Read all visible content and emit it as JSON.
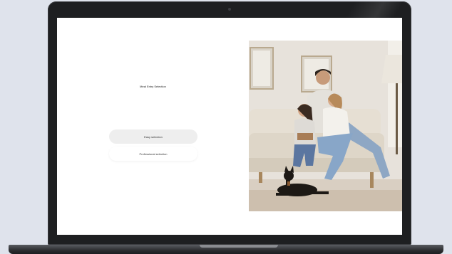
{
  "selection": {
    "title": "Meal Entry Selection",
    "easy_label": "Easy selection",
    "professional_label": "Professional selection"
  },
  "colors": {
    "page_background": "#dfe3ec",
    "laptop_frame": "#1e1f21",
    "screen_background": "#ffffff",
    "easy_button_background": "#eeeeee"
  }
}
